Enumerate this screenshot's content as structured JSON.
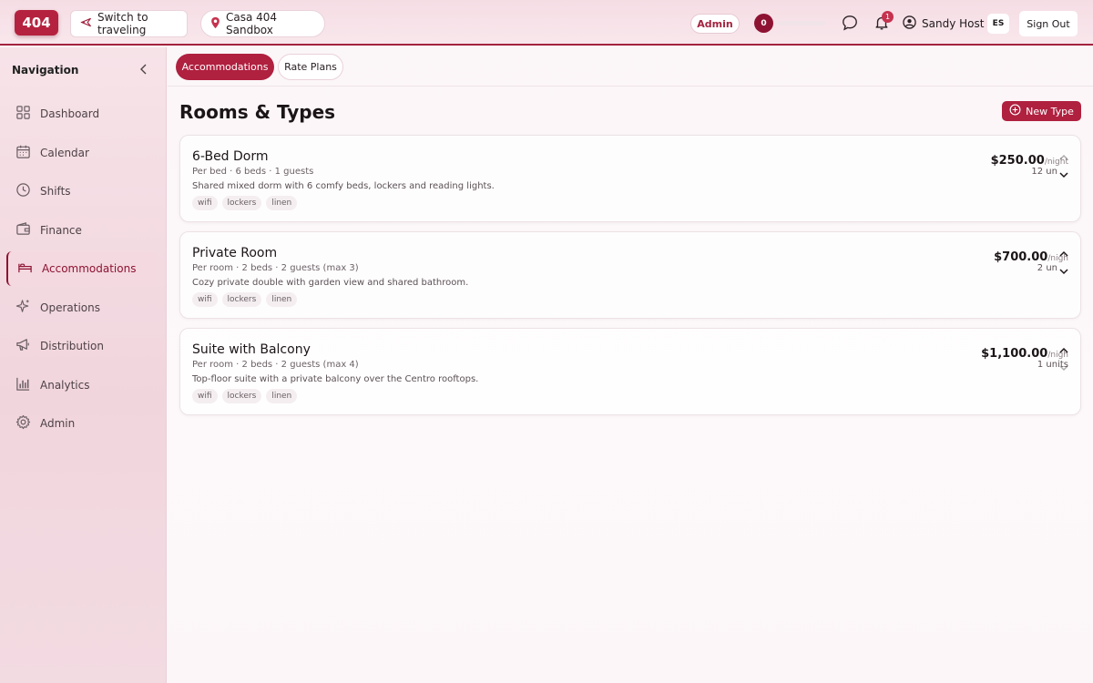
{
  "header": {
    "logo": "404",
    "switch_label": "Switch to traveling",
    "property_label": "Casa 404 Sandbox",
    "role_badge": "Admin",
    "score": "0",
    "score_fraction": 0,
    "notification_count": "1",
    "user_name": "Sandy Host",
    "language": "ES",
    "signout_label": "Sign Out"
  },
  "sidebar": {
    "title": "Navigation",
    "items": [
      {
        "label": "Dashboard",
        "icon": "grid-icon"
      },
      {
        "label": "Calendar",
        "icon": "calendar-icon"
      },
      {
        "label": "Shifts",
        "icon": "clock-icon"
      },
      {
        "label": "Finance",
        "icon": "wallet-icon"
      },
      {
        "label": "Accommodations",
        "icon": "bed-icon"
      },
      {
        "label": "Operations",
        "icon": "sparkle-icon"
      },
      {
        "label": "Distribution",
        "icon": "megaphone-icon"
      },
      {
        "label": "Analytics",
        "icon": "bar-chart-icon"
      },
      {
        "label": "Admin",
        "icon": "gear-icon"
      }
    ]
  },
  "tabs": [
    {
      "label": "Accommodations"
    },
    {
      "label": "Rate Plans"
    }
  ],
  "page": {
    "title": "Rooms & Types",
    "new_type_label": "New Type"
  },
  "rooms": [
    {
      "name": "6-Bed Dorm",
      "meta": "Per bed · 6 beds · 1 guests",
      "description": "Shared mixed dorm with 6 comfy beds, lockers and reading lights.",
      "tags": [
        "wifi",
        "lockers",
        "linen"
      ],
      "price": "$250.00",
      "price_unit": "/night",
      "units": "12 un"
    },
    {
      "name": "Private Room",
      "meta": "Per room · 2 beds · 2 guests (max 3)",
      "description": "Cozy private double with garden view and shared bathroom.",
      "tags": [
        "wifi",
        "lockers",
        "linen"
      ],
      "price": "$700.00",
      "price_unit": "/nigh",
      "units": "2 un"
    },
    {
      "name": "Suite with Balcony",
      "meta": "Per room · 2 beds · 2 guests (max 4)",
      "description": "Top-floor suite with a private balcony over the Centro rooftops.",
      "tags": [
        "wifi",
        "lockers",
        "linen"
      ],
      "price": "$1,100.00",
      "price_unit": "/nigh",
      "units": "1 units"
    }
  ],
  "colors": {
    "brand": "#b0203f",
    "brand_dark": "#8e1332"
  }
}
